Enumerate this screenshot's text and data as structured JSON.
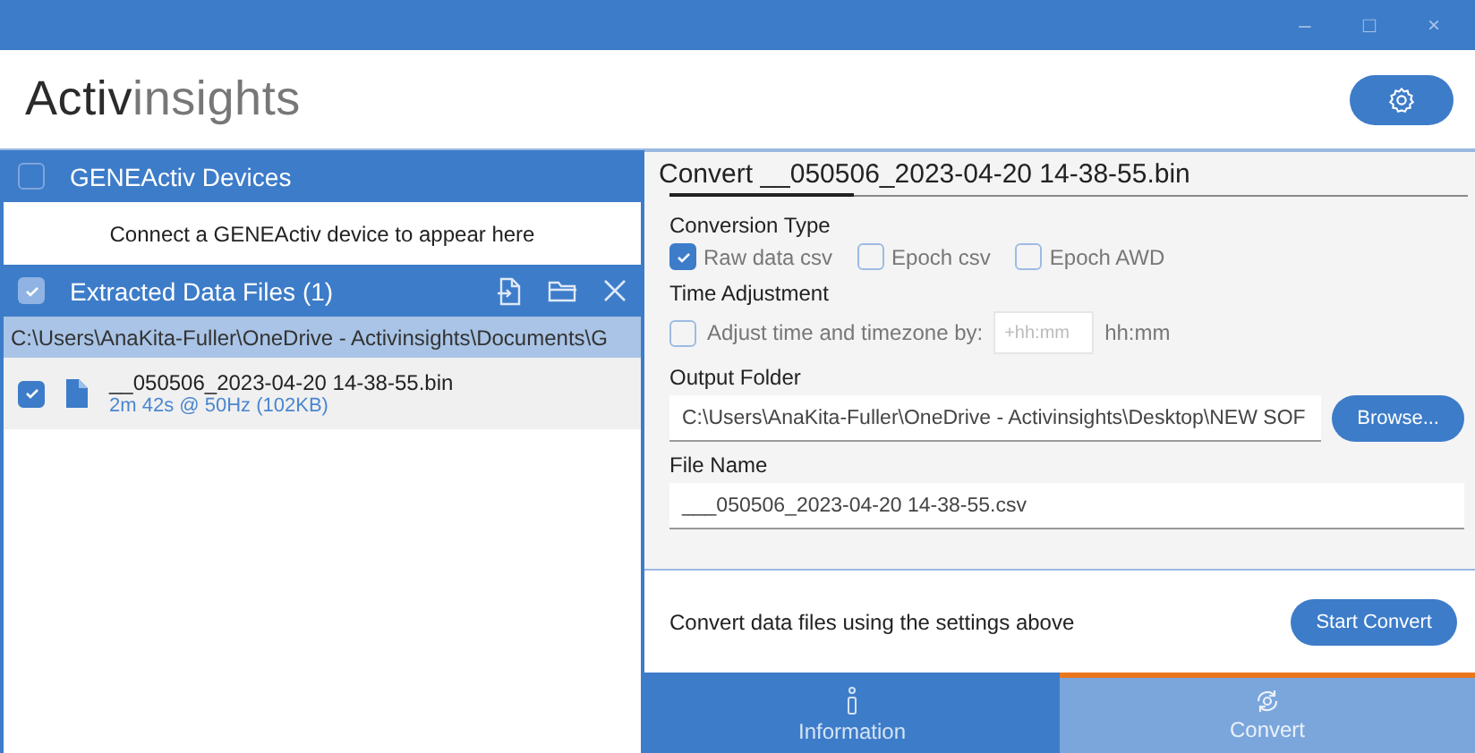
{
  "window": {
    "controls": [
      "–",
      "□",
      "×"
    ]
  },
  "logo": {
    "dark": "Activ",
    "light": "insights"
  },
  "devices": {
    "title": "GENEActiv Devices",
    "checked": false,
    "message": "Connect a GENEActiv device to appear here"
  },
  "extracted": {
    "title": "Extracted Data Files (1)",
    "checked": true,
    "path": "C:\\Users\\AnaKita-Fuller\\OneDrive - Activinsights\\Documents\\G",
    "files": [
      {
        "name": "__050506_2023-04-20 14-38-55.bin",
        "detail": "2m 42s @ 50Hz (102KB)",
        "checked": true
      }
    ]
  },
  "convert": {
    "title": "Convert __050506_2023-04-20 14-38-55.bin",
    "conversion_type": {
      "label": "Conversion Type",
      "options": [
        {
          "label": "Raw data csv",
          "checked": true
        },
        {
          "label": "Epoch csv",
          "checked": false
        },
        {
          "label": "Epoch AWD",
          "checked": false
        }
      ]
    },
    "time_adjustment": {
      "label": "Time Adjustment",
      "option": "Adjust time and timezone by:",
      "checked": false,
      "placeholder": "+hh:mm",
      "unit": "hh:mm"
    },
    "output_folder": {
      "label": "Output Folder",
      "value": "C:\\Users\\AnaKita-Fuller\\OneDrive - Activinsights\\Desktop\\NEW SOF",
      "button": "Browse..."
    },
    "file_name": {
      "label": "File Name",
      "value": "___050506_2023-04-20 14-38-55.csv"
    },
    "footer_text": "Convert data files using the settings above",
    "start_button": "Start Convert"
  },
  "tabs": [
    {
      "label": "Information",
      "kind": "info",
      "selected": false
    },
    {
      "label": "Convert",
      "kind": "convert",
      "selected": true
    }
  ]
}
